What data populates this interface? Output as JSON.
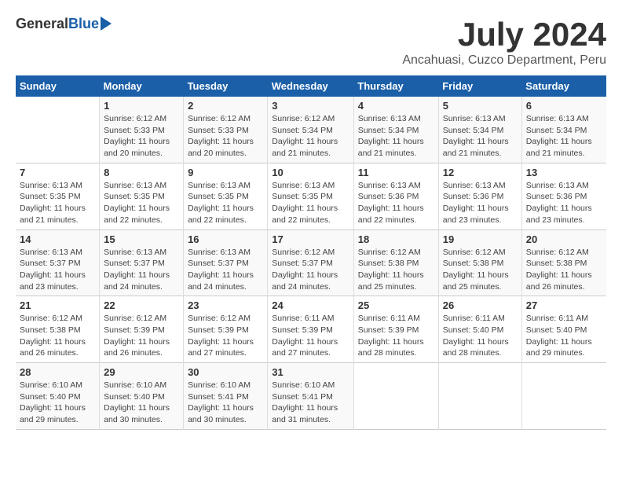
{
  "header": {
    "logo_general": "General",
    "logo_blue": "Blue",
    "month": "July 2024",
    "location": "Ancahuasi, Cuzco Department, Peru"
  },
  "weekdays": [
    "Sunday",
    "Monday",
    "Tuesday",
    "Wednesday",
    "Thursday",
    "Friday",
    "Saturday"
  ],
  "weeks": [
    [
      {
        "day": "",
        "info": ""
      },
      {
        "day": "1",
        "info": "Sunrise: 6:12 AM\nSunset: 5:33 PM\nDaylight: 11 hours\nand 20 minutes."
      },
      {
        "day": "2",
        "info": "Sunrise: 6:12 AM\nSunset: 5:33 PM\nDaylight: 11 hours\nand 20 minutes."
      },
      {
        "day": "3",
        "info": "Sunrise: 6:12 AM\nSunset: 5:34 PM\nDaylight: 11 hours\nand 21 minutes."
      },
      {
        "day": "4",
        "info": "Sunrise: 6:13 AM\nSunset: 5:34 PM\nDaylight: 11 hours\nand 21 minutes."
      },
      {
        "day": "5",
        "info": "Sunrise: 6:13 AM\nSunset: 5:34 PM\nDaylight: 11 hours\nand 21 minutes."
      },
      {
        "day": "6",
        "info": "Sunrise: 6:13 AM\nSunset: 5:34 PM\nDaylight: 11 hours\nand 21 minutes."
      }
    ],
    [
      {
        "day": "7",
        "info": "Sunrise: 6:13 AM\nSunset: 5:35 PM\nDaylight: 11 hours\nand 21 minutes."
      },
      {
        "day": "8",
        "info": "Sunrise: 6:13 AM\nSunset: 5:35 PM\nDaylight: 11 hours\nand 22 minutes."
      },
      {
        "day": "9",
        "info": "Sunrise: 6:13 AM\nSunset: 5:35 PM\nDaylight: 11 hours\nand 22 minutes."
      },
      {
        "day": "10",
        "info": "Sunrise: 6:13 AM\nSunset: 5:35 PM\nDaylight: 11 hours\nand 22 minutes."
      },
      {
        "day": "11",
        "info": "Sunrise: 6:13 AM\nSunset: 5:36 PM\nDaylight: 11 hours\nand 22 minutes."
      },
      {
        "day": "12",
        "info": "Sunrise: 6:13 AM\nSunset: 5:36 PM\nDaylight: 11 hours\nand 23 minutes."
      },
      {
        "day": "13",
        "info": "Sunrise: 6:13 AM\nSunset: 5:36 PM\nDaylight: 11 hours\nand 23 minutes."
      }
    ],
    [
      {
        "day": "14",
        "info": "Sunrise: 6:13 AM\nSunset: 5:37 PM\nDaylight: 11 hours\nand 23 minutes."
      },
      {
        "day": "15",
        "info": "Sunrise: 6:13 AM\nSunset: 5:37 PM\nDaylight: 11 hours\nand 24 minutes."
      },
      {
        "day": "16",
        "info": "Sunrise: 6:13 AM\nSunset: 5:37 PM\nDaylight: 11 hours\nand 24 minutes."
      },
      {
        "day": "17",
        "info": "Sunrise: 6:12 AM\nSunset: 5:37 PM\nDaylight: 11 hours\nand 24 minutes."
      },
      {
        "day": "18",
        "info": "Sunrise: 6:12 AM\nSunset: 5:38 PM\nDaylight: 11 hours\nand 25 minutes."
      },
      {
        "day": "19",
        "info": "Sunrise: 6:12 AM\nSunset: 5:38 PM\nDaylight: 11 hours\nand 25 minutes."
      },
      {
        "day": "20",
        "info": "Sunrise: 6:12 AM\nSunset: 5:38 PM\nDaylight: 11 hours\nand 26 minutes."
      }
    ],
    [
      {
        "day": "21",
        "info": "Sunrise: 6:12 AM\nSunset: 5:38 PM\nDaylight: 11 hours\nand 26 minutes."
      },
      {
        "day": "22",
        "info": "Sunrise: 6:12 AM\nSunset: 5:39 PM\nDaylight: 11 hours\nand 26 minutes."
      },
      {
        "day": "23",
        "info": "Sunrise: 6:12 AM\nSunset: 5:39 PM\nDaylight: 11 hours\nand 27 minutes."
      },
      {
        "day": "24",
        "info": "Sunrise: 6:11 AM\nSunset: 5:39 PM\nDaylight: 11 hours\nand 27 minutes."
      },
      {
        "day": "25",
        "info": "Sunrise: 6:11 AM\nSunset: 5:39 PM\nDaylight: 11 hours\nand 28 minutes."
      },
      {
        "day": "26",
        "info": "Sunrise: 6:11 AM\nSunset: 5:40 PM\nDaylight: 11 hours\nand 28 minutes."
      },
      {
        "day": "27",
        "info": "Sunrise: 6:11 AM\nSunset: 5:40 PM\nDaylight: 11 hours\nand 29 minutes."
      }
    ],
    [
      {
        "day": "28",
        "info": "Sunrise: 6:10 AM\nSunset: 5:40 PM\nDaylight: 11 hours\nand 29 minutes."
      },
      {
        "day": "29",
        "info": "Sunrise: 6:10 AM\nSunset: 5:40 PM\nDaylight: 11 hours\nand 30 minutes."
      },
      {
        "day": "30",
        "info": "Sunrise: 6:10 AM\nSunset: 5:41 PM\nDaylight: 11 hours\nand 30 minutes."
      },
      {
        "day": "31",
        "info": "Sunrise: 6:10 AM\nSunset: 5:41 PM\nDaylight: 11 hours\nand 31 minutes."
      },
      {
        "day": "",
        "info": ""
      },
      {
        "day": "",
        "info": ""
      },
      {
        "day": "",
        "info": ""
      }
    ]
  ]
}
